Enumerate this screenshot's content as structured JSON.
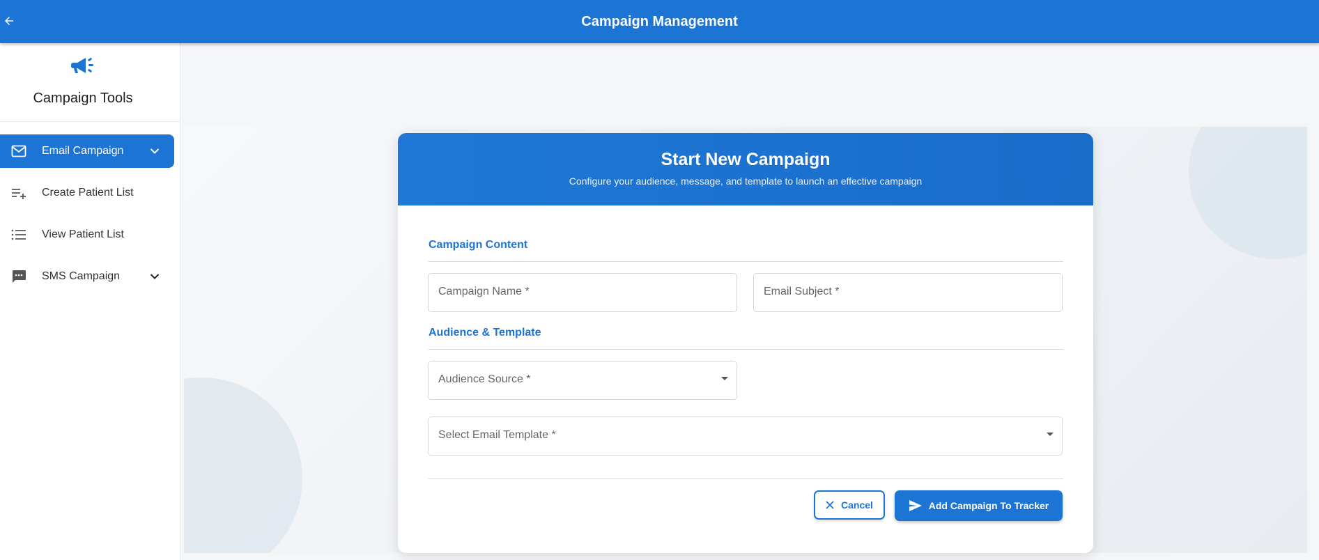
{
  "app": {
    "title": "Campaign Management"
  },
  "sidebar": {
    "title": "Campaign Tools",
    "logo_icon": "megaphone-icon",
    "items": [
      {
        "label": "Email Campaign",
        "icon": "mail-icon",
        "expandable": true,
        "active": true
      },
      {
        "label": "Create Patient List",
        "icon": "playlist-add-icon",
        "expandable": false,
        "active": false
      },
      {
        "label": "View Patient List",
        "icon": "list-icon",
        "expandable": false,
        "active": false
      },
      {
        "label": "SMS Campaign",
        "icon": "sms-icon",
        "expandable": true,
        "active": false
      }
    ]
  },
  "card": {
    "title": "Start New Campaign",
    "subtitle": "Configure your audience, message, and template to launch an effective campaign"
  },
  "sections": {
    "content": {
      "title": "Campaign Content",
      "campaign_name": {
        "placeholder": "Campaign Name *",
        "value": ""
      },
      "email_subject": {
        "placeholder": "Email Subject *",
        "value": ""
      }
    },
    "audience": {
      "title": "Audience & Template",
      "audience_source": {
        "placeholder": "Audience Source *",
        "value": ""
      },
      "email_template": {
        "placeholder": "Select Email Template *",
        "value": ""
      }
    }
  },
  "actions": {
    "cancel_label": "Cancel",
    "add_label": "Add Campaign To Tracker"
  },
  "colors": {
    "primary": "#1c74d4",
    "background": "#f5f6f8"
  }
}
